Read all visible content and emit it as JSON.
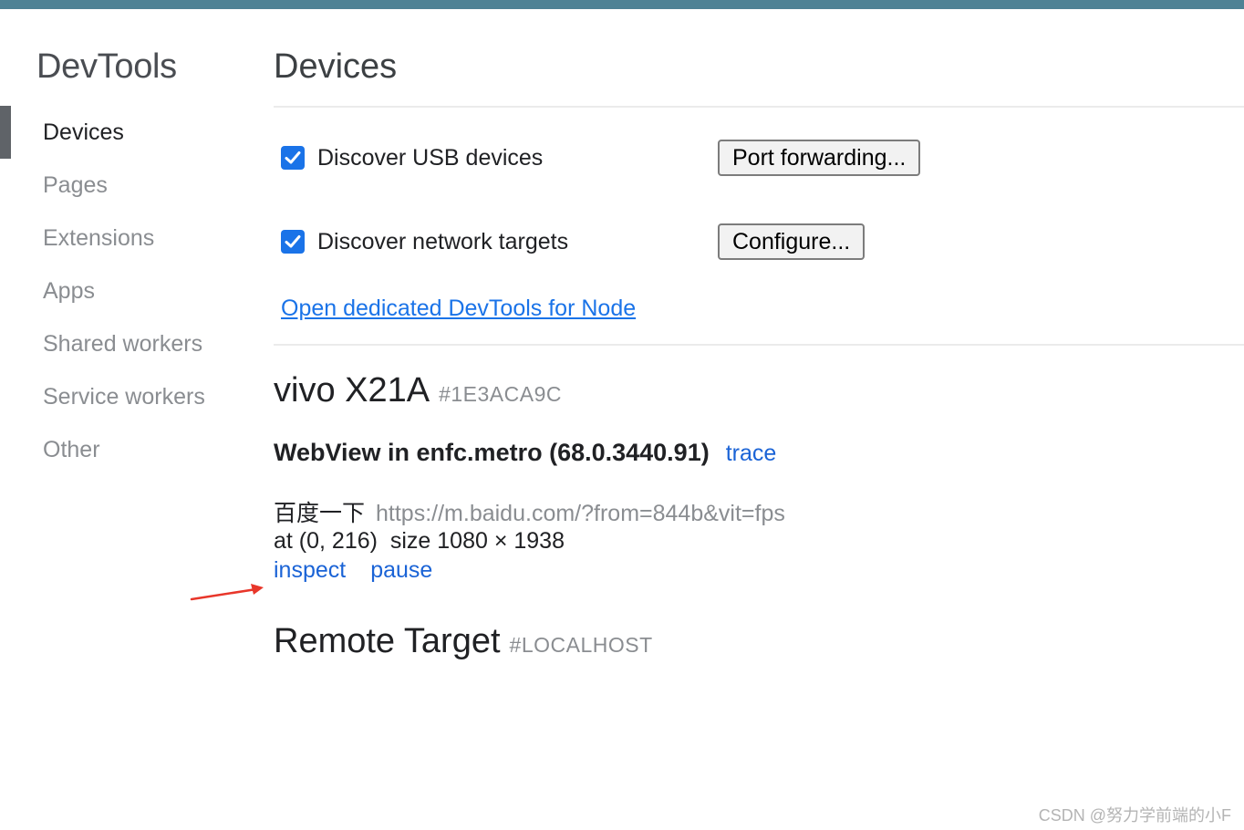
{
  "sidebar": {
    "title": "DevTools",
    "items": [
      {
        "label": "Devices",
        "active": true
      },
      {
        "label": "Pages",
        "active": false
      },
      {
        "label": "Extensions",
        "active": false
      },
      {
        "label": "Apps",
        "active": false
      },
      {
        "label": "Shared workers",
        "active": false
      },
      {
        "label": "Service workers",
        "active": false
      },
      {
        "label": "Other",
        "active": false
      }
    ]
  },
  "main": {
    "title": "Devices",
    "options": {
      "usb": {
        "label": "Discover USB devices",
        "checked": true,
        "button": "Port forwarding..."
      },
      "network": {
        "label": "Discover network targets",
        "checked": true,
        "button": "Configure..."
      }
    },
    "node_link": "Open dedicated DevTools for Node",
    "device": {
      "name": "vivo X21A",
      "serial": "#1E3ACA9C",
      "browser": {
        "name": "WebView in enfc.metro (68.0.3440.91)",
        "trace": "trace",
        "page": {
          "title": "百度一下",
          "url": "https://m.baidu.com/?from=844b&vit=fps",
          "position": "at (0, 216)",
          "size": "size 1080 × 1938",
          "actions": {
            "inspect": "inspect",
            "pause": "pause"
          }
        }
      }
    },
    "remote_target": {
      "name": "Remote Target",
      "tag": "#LOCALHOST"
    }
  },
  "colors": {
    "top_bar": "#4e8295",
    "link": "#1a63d6",
    "checkbox": "#1a73e8",
    "arrow": "#e8362a"
  },
  "watermark": "CSDN @努力学前端的小F"
}
